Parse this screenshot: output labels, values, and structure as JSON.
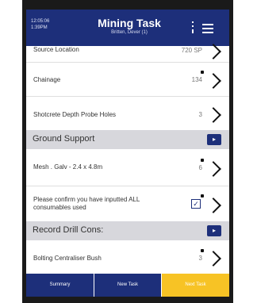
{
  "header": {
    "time": "12:05:06",
    "time2": "1:39PM",
    "title": "Mining Task",
    "subtitle": "Britten, Dever (1)"
  },
  "rows": [
    {
      "label": "Source Location",
      "value": "720 SP"
    },
    {
      "label": "Chainage",
      "value": "134"
    },
    {
      "label": "Shotcrete Depth Probe Holes",
      "value": "3"
    }
  ],
  "sections": [
    {
      "title": "Ground Support",
      "button": "▸"
    },
    {
      "title": "Record Drill Cons:",
      "button": "▸"
    }
  ],
  "ground_support": {
    "mesh_label": "Mesh . Galv - 2.4 x 4.8m",
    "mesh_value": "6",
    "confirm_label_1": "Please confirm you have inputted ALL",
    "confirm_label_2": "consumables used",
    "checkmark": "✓"
  },
  "drill_cons": {
    "label": "Bolting Centraliser Bush",
    "value": "3"
  },
  "bottom": {
    "summary": "Summary",
    "new_task": "New Task",
    "next_task": "Next Task"
  },
  "colors": {
    "primary": "#1d2f7a",
    "accent": "#f7c325",
    "section_bg": "#d7d7dc"
  }
}
